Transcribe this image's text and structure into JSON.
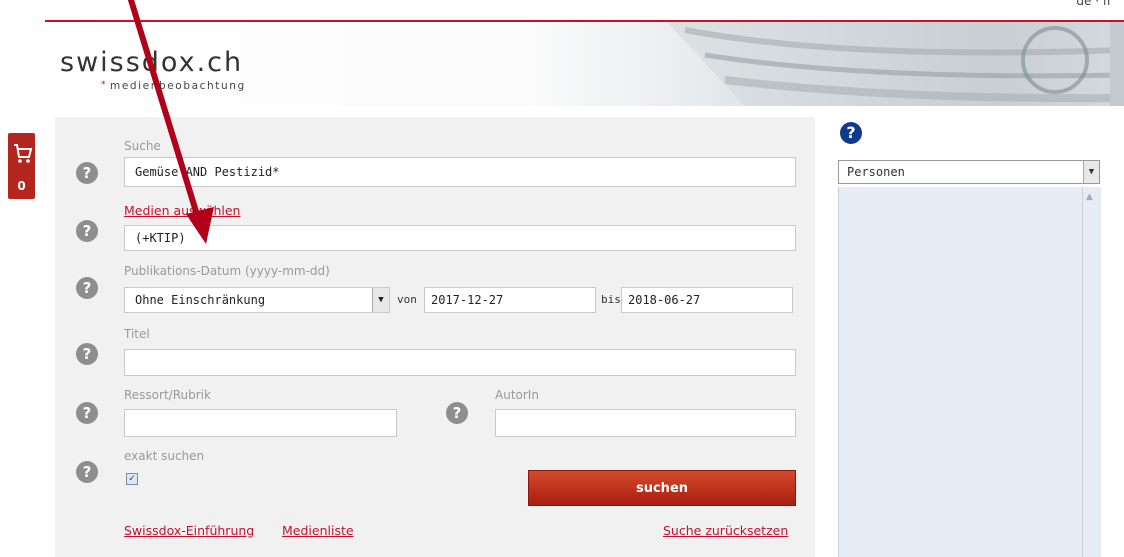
{
  "header": {
    "logo_text": "swissdox.ch",
    "logo_subtitle": "medienbeobachtung",
    "language_text": "de · fr"
  },
  "cart": {
    "count": "0",
    "icon": "cart-icon"
  },
  "form": {
    "search_label": "Suche",
    "search_value": "Gemüse AND Pestizid*",
    "media_link": "Medien auswählen",
    "media_value": "(+KTIP)",
    "date_label": "Publikations-Datum (yyyy-mm-dd)",
    "date_option": "Ohne Einschränkung",
    "von_label": "von",
    "von_value": "2017-12-27",
    "bis_label": "bis",
    "bis_value": "2018-06-27",
    "title_label": "Titel",
    "title_value": "",
    "ressort_label": "Ressort/Rubrik",
    "ressort_value": "",
    "autor_label": "AutorIn",
    "autor_value": "",
    "exact_label": "exakt suchen",
    "exact_checked": true,
    "submit_label": "suchen",
    "link_intro": "Swissdox-Einführung",
    "link_medienliste": "Medienliste",
    "link_reset": "Suche zurücksetzen"
  },
  "sidebar": {
    "select_value": "Personen",
    "help_icon": "help-icon"
  },
  "colors": {
    "accent": "#c8102e",
    "button": "#b32a17",
    "help_blue": "#123a8c",
    "arrow": "#b0001a"
  }
}
